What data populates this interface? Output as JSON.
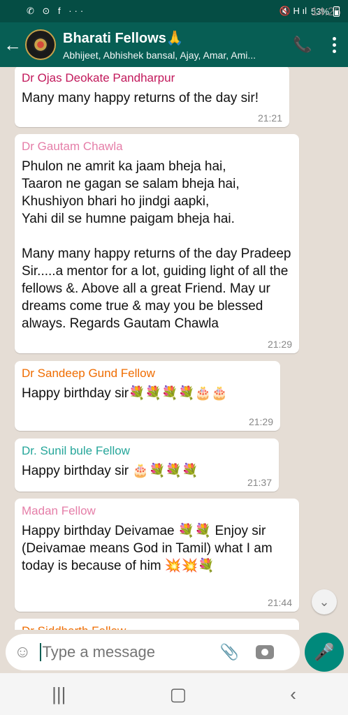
{
  "status_bar": {
    "time": "14:25",
    "left_icons": "✆ ⊙ f ···",
    "right_icons": "🔇 H ıl",
    "battery": "53%"
  },
  "header": {
    "title": "Bharati Fellows🙏",
    "subtitle": "Abhijeet, Abhishek bansal, Ajay, Amar, Ami..."
  },
  "messages": [
    {
      "sender": "Dr Ojas Deokate Pandharpur",
      "color": "#c2185b",
      "text": "Many many happy returns of the day sir!",
      "time": "21:21"
    },
    {
      "sender": "Dr Gautam Chawla",
      "color": "#e57ea8",
      "text": "Phulon ne amrit ka jaam bheja hai,\nTaaron ne gagan se salam bheja hai,\nKhushiyon bhari ho jindgi aapki,\nYahi dil se humne paigam bheja hai.\n\nMany many happy returns of the day Pradeep Sir.....a mentor for a lot, guiding light of all the fellows &. Above all a great Friend. May ur dreams come true & may you be blessed always. Regards Gautam Chawla",
      "time": "21:29"
    },
    {
      "sender": "Dr Sandeep Gund Fellow",
      "color": "#ef6c00",
      "text": "Happy birthday sir💐💐💐💐🎂🎂",
      "time": "21:29"
    },
    {
      "sender": "Dr. Sunil bule Fellow",
      "color": "#26a69a",
      "text": "Happy birthday sir 🎂💐💐💐",
      "time": "21:37"
    },
    {
      "sender": "Madan Fellow",
      "color": "#e57ea8",
      "text": "Happy birthday Deivamae 💐💐 Enjoy sir (Deivamae means God in Tamil) what I am today is because of him 💥💥💐",
      "time": "21:44"
    },
    {
      "sender": "Dr Siddharth Fellow",
      "color": "#ef6c00",
      "text": "",
      "time": ""
    }
  ],
  "composer": {
    "placeholder": "Type a message"
  },
  "colors": {
    "appbar": "#075e54",
    "statusbar": "#054d44",
    "mic": "#00897b",
    "chat_bg": "#e5ddd5"
  },
  "icons": [
    "back-arrow-icon",
    "add-call-icon",
    "menu-icon",
    "emoji-icon",
    "attach-icon",
    "camera-icon",
    "mic-icon",
    "scroll-down-icon"
  ]
}
